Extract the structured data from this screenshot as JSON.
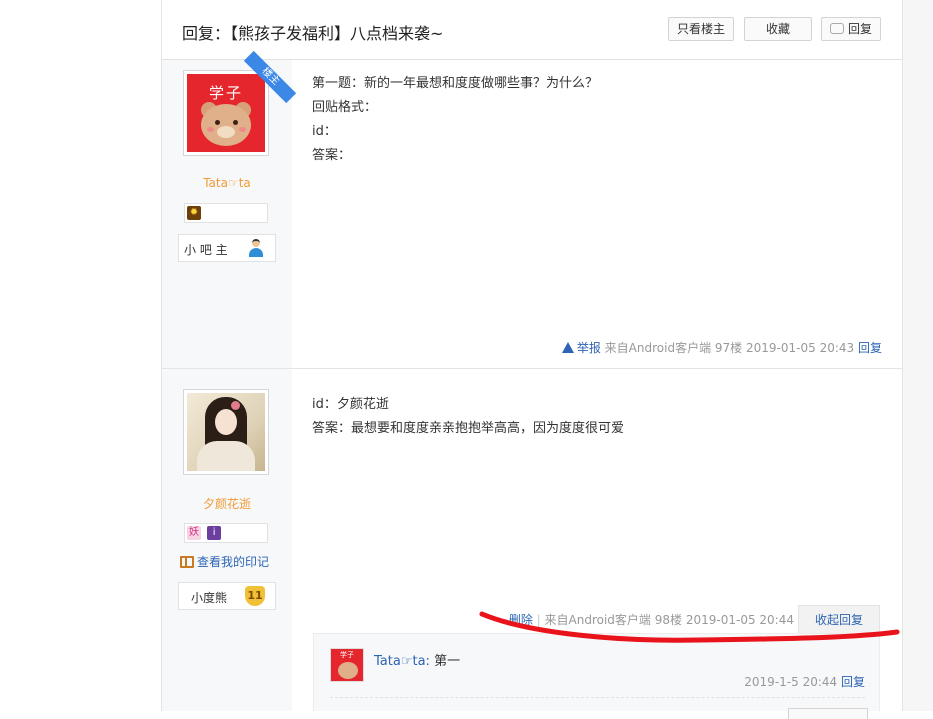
{
  "thread": {
    "title": "回复：【熊孩子发福利】八点档来袭~",
    "btn_only_op": "只看楼主",
    "btn_favorite": "收藏",
    "btn_reply": "回复"
  },
  "posts": [
    {
      "avatar_text": "学子",
      "op_tag": "楼主",
      "username": "Tata☞ta",
      "level_name": "小 吧 主",
      "content": [
        "第一题：新的一年最想和度度做哪些事？为什么？",
        "回贴格式：",
        "id：",
        "答案："
      ],
      "report": "举报",
      "source": "来自Android客户端",
      "floor": "97楼",
      "time": "2019-01-05 20:43",
      "reply": "回复"
    },
    {
      "username": "夕颜花逝",
      "badge1": "妖",
      "badge2": "i",
      "view_marks": "查看我的印记",
      "level_name": "小度熊",
      "level_num": "11",
      "content": [
        "id：夕颜花逝",
        "答案：最想要和度度亲亲抱抱举高高，因为度度很可爱"
      ],
      "delete": "删除",
      "source": "来自Android客户端",
      "floor": "98楼",
      "time": "2019-01-05 20:44",
      "collapse": "收起回复",
      "sub_reply": {
        "avatar_text": "学子",
        "username": "Tata☞ta",
        "text": "第一",
        "time": "2019-1-5 20:44",
        "reply": "回复"
      }
    }
  ],
  "colors": {
    "link": "#2d64b3",
    "username": "#f29b38",
    "annotation": "#e8131b"
  }
}
